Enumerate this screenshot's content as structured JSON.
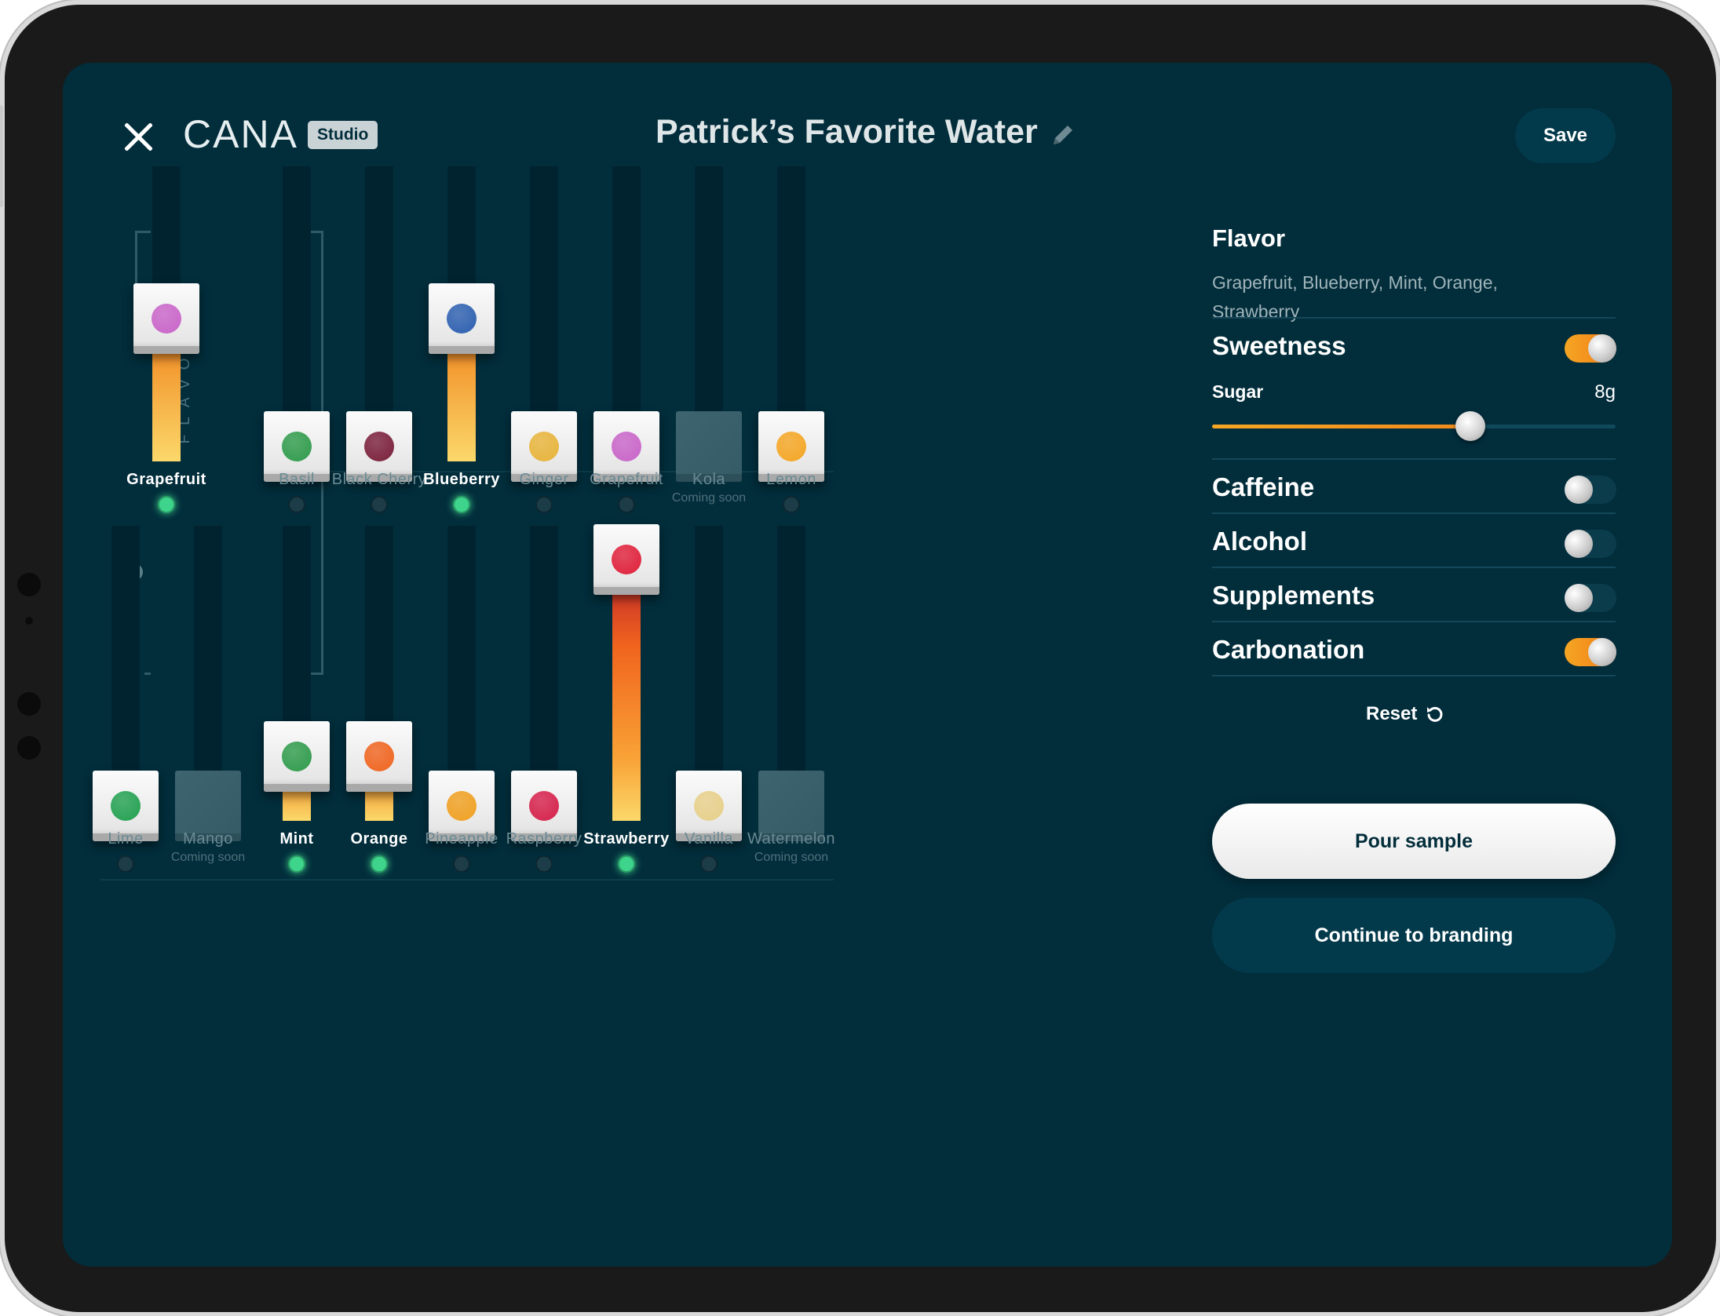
{
  "header": {
    "brand": "CANA",
    "badge": "Studio",
    "title": "Patrick’s Favorite Water",
    "save_label": "Save"
  },
  "key_flavor_label": "KEY FLAVOR",
  "flavors_row1": [
    {
      "name": "Grapefruit",
      "sub": "",
      "level": 0.52,
      "active": true,
      "disabled": false,
      "icon": "grapefruit-icon",
      "color": "#c964c9"
    },
    {
      "name": "Basil",
      "sub": "",
      "level": 0.0,
      "active": false,
      "disabled": false,
      "icon": "basil-icon",
      "color": "#2f9b4b"
    },
    {
      "name": "Black Cherry",
      "sub": "",
      "level": 0.0,
      "active": false,
      "disabled": false,
      "icon": "black-cherry-icon",
      "color": "#7a1f3a"
    },
    {
      "name": "Blueberry",
      "sub": "",
      "level": 0.52,
      "active": true,
      "disabled": false,
      "icon": "blueberry-icon",
      "color": "#2c5fb0"
    },
    {
      "name": "Ginger",
      "sub": "",
      "level": 0.0,
      "active": false,
      "disabled": false,
      "icon": "ginger-icon",
      "color": "#e8b43a"
    },
    {
      "name": "Grapefruit",
      "sub": "",
      "level": 0.0,
      "active": false,
      "disabled": false,
      "icon": "grapefruit-icon",
      "color": "#c964c9"
    },
    {
      "name": "Kola",
      "sub": "Coming soon",
      "level": 0.0,
      "active": false,
      "disabled": true,
      "icon": "kola-icon",
      "color": "#3e6470"
    },
    {
      "name": "Lemon",
      "sub": "",
      "level": 0.0,
      "active": false,
      "disabled": false,
      "icon": "lemon-icon",
      "color": "#f5a623"
    }
  ],
  "flavors_row2": [
    {
      "name": "Lime",
      "sub": "",
      "level": 0.0,
      "active": false,
      "disabled": false,
      "icon": "lime-icon",
      "color": "#22a150"
    },
    {
      "name": "Mango",
      "sub": "Coming soon",
      "level": 0.0,
      "active": false,
      "disabled": true,
      "icon": "mango-icon",
      "color": "#3e6470"
    },
    {
      "name": "Mint",
      "sub": "",
      "level": 0.2,
      "active": true,
      "disabled": false,
      "icon": "mint-icon",
      "color": "#2f9b4b"
    },
    {
      "name": "Orange",
      "sub": "",
      "level": 0.2,
      "active": true,
      "disabled": false,
      "icon": "orange-icon",
      "color": "#f0641e"
    },
    {
      "name": "Pineapple",
      "sub": "",
      "level": 0.0,
      "active": false,
      "disabled": false,
      "icon": "pineapple-icon",
      "color": "#f0a020"
    },
    {
      "name": "Raspberry",
      "sub": "",
      "level": 0.0,
      "active": false,
      "disabled": false,
      "icon": "raspberry-icon",
      "color": "#d6204a"
    },
    {
      "name": "Strawberry",
      "sub": "",
      "level": 1.0,
      "active": true,
      "disabled": false,
      "icon": "strawberry-icon",
      "color": "#e0203a"
    },
    {
      "name": "Vanilla",
      "sub": "",
      "level": 0.0,
      "active": false,
      "disabled": false,
      "icon": "vanilla-icon",
      "color": "#e8d08a"
    },
    {
      "name": "Watermelon",
      "sub": "Coming soon",
      "level": 0.0,
      "active": false,
      "disabled": true,
      "icon": "watermelon-icon",
      "color": "#3e6470"
    }
  ],
  "panel": {
    "flavor_title": "Flavor",
    "flavor_list": "Grapefruit, Blueberry, Mint, Orange, Strawberry",
    "sweetness": {
      "label": "Sweetness",
      "on": true
    },
    "sugar": {
      "label": "Sugar",
      "value": "8g",
      "fraction": 0.64
    },
    "caffeine": {
      "label": "Caffeine",
      "on": false
    },
    "alcohol": {
      "label": "Alcohol",
      "on": false
    },
    "supplements": {
      "label": "Supplements",
      "on": false
    },
    "carbonation": {
      "label": "Carbonation",
      "on": true
    },
    "reset_label": "Reset",
    "pour_label": "Pour sample",
    "branding_label": "Continue to branding"
  },
  "colors": {
    "background": "#022d3b",
    "accent_orange": "#f5a623",
    "active_led": "#3ed48b"
  }
}
